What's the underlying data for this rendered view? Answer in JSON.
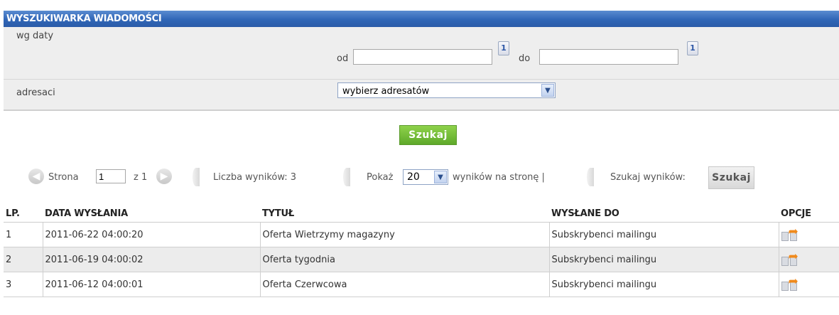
{
  "panel": {
    "title": "WYSZUKIWARKA WIADOMOŚCI",
    "date_label": "wg daty",
    "from_label": "od",
    "from_value": "",
    "to_label": "do",
    "to_value": "",
    "calendar_glyph": "1",
    "recipients_label": "adresaci",
    "recipients_selected": "wybierz adresatów"
  },
  "search_button": "Szukaj",
  "pager": {
    "page_label": "Strona",
    "page_value": "1",
    "of_text": "z 1",
    "results_count": "Liczba wyników: 3",
    "show_label": "Pokaż",
    "per_page": "20",
    "per_page_suffix": "wyników na stronę |",
    "search_results_label": "Szukaj wyników:",
    "search_results_button": "Szukaj"
  },
  "table": {
    "headers": [
      "LP.",
      "DATA WYSŁANIA",
      "TYTUŁ",
      "WYSŁANE DO",
      "OPCJE"
    ],
    "rows": [
      [
        "1",
        "2011-06-22 04:00:20",
        "Oferta Wietrzymy magazyny",
        "Subskrybenci mailingu"
      ],
      [
        "2",
        "2011-06-19 04:00:02",
        "Oferta tygodnia",
        "Subskrybenci mailingu"
      ],
      [
        "3",
        "2011-06-12 04:00:01",
        "Oferta Czerwcowa",
        "Subskrybenci mailingu"
      ]
    ]
  },
  "colors": {
    "header_blue": "#3066b7",
    "button_green": "#6cb733",
    "row_alt": "#ececec",
    "forward_orange": "#f08a1c"
  },
  "icons": {
    "prev": "arrow-left-circle-icon",
    "next": "arrow-right-circle-icon",
    "calendar": "calendar-icon",
    "dropdown": "chevron-down-icon",
    "forward": "forward-message-icon"
  }
}
